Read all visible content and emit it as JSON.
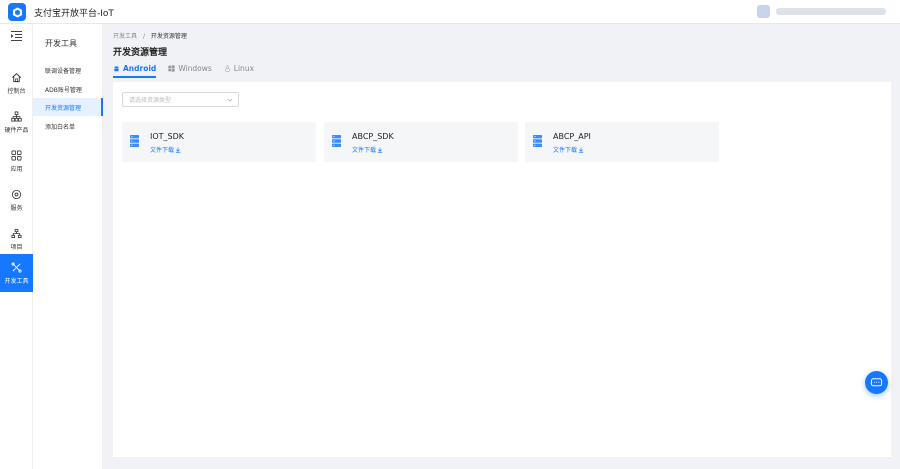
{
  "app": {
    "title": "支付宝开放平台-IoT"
  },
  "nav": {
    "items": [
      {
        "label": "控制台",
        "icon": "home-icon"
      },
      {
        "label": "硬件产品",
        "icon": "hierarchy-icon"
      },
      {
        "label": "应用",
        "icon": "apps-icon"
      },
      {
        "label": "服务",
        "icon": "settings-icon"
      },
      {
        "label": "项目",
        "icon": "project-icon"
      },
      {
        "label": "开发工具",
        "icon": "tools-icon"
      }
    ]
  },
  "subnav": {
    "title": "开发工具",
    "items": [
      {
        "label": "联调设备管理"
      },
      {
        "label": "ADB账号管理"
      },
      {
        "label": "开发资源管理"
      },
      {
        "label": "添加白名单"
      }
    ]
  },
  "breadcrumb": {
    "root": "开发工具",
    "separator": "/",
    "current": "开发资源管理"
  },
  "page": {
    "title": "开发资源管理"
  },
  "tabs": [
    {
      "label": "Android",
      "icon": "android-icon"
    },
    {
      "label": "Windows",
      "icon": "windows-icon"
    },
    {
      "label": "Linux",
      "icon": "linux-icon"
    }
  ],
  "filter": {
    "placeholder": "请选择资源类型"
  },
  "cards": [
    {
      "title": "IOT_SDK",
      "link": "文件下载"
    },
    {
      "title": "ABCP_SDK",
      "link": "文件下载"
    },
    {
      "title": "ABCP_API",
      "link": "文件下载"
    }
  ],
  "colors": {
    "accent": "#1677ff",
    "background": "#f0f2f5",
    "card": "#f5f6f8"
  }
}
